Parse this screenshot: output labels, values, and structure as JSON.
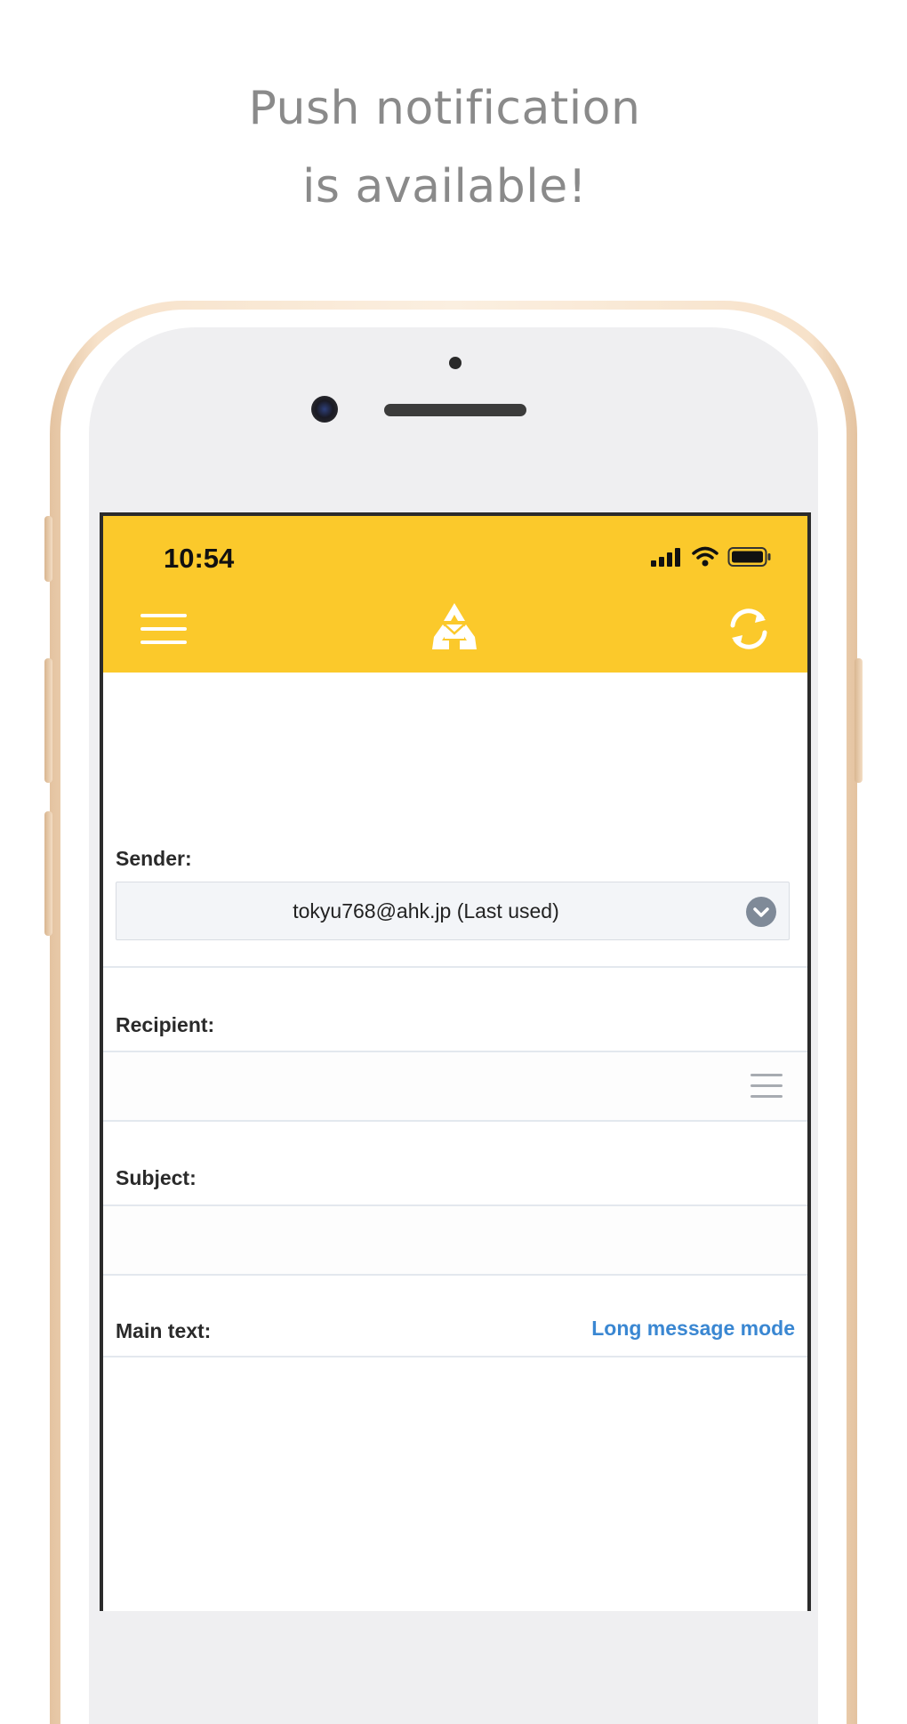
{
  "promo": {
    "line1": "Push notification",
    "line2": "is available!"
  },
  "status_bar": {
    "time": "10:54",
    "icons": [
      "cellular-signal-icon",
      "wifi-icon",
      "battery-icon"
    ]
  },
  "nav": {
    "menu_icon": "hamburger-menu-icon",
    "logo_icon": "recycle-mail-logo-icon",
    "refresh_icon": "refresh-icon",
    "bar_color": "#fbc92b"
  },
  "form": {
    "sender_label": "Sender:",
    "sender_value": "tokyu768@ahk.jp (Last used)",
    "recipient_label": "Recipient:",
    "recipient_value": "",
    "subject_label": "Subject:",
    "subject_value": "",
    "main_text_label": "Main text:",
    "long_message_link": "Long message mode",
    "main_text_value": ""
  },
  "colors": {
    "link": "#3a87d2",
    "promo_text": "#8a8a8a"
  }
}
